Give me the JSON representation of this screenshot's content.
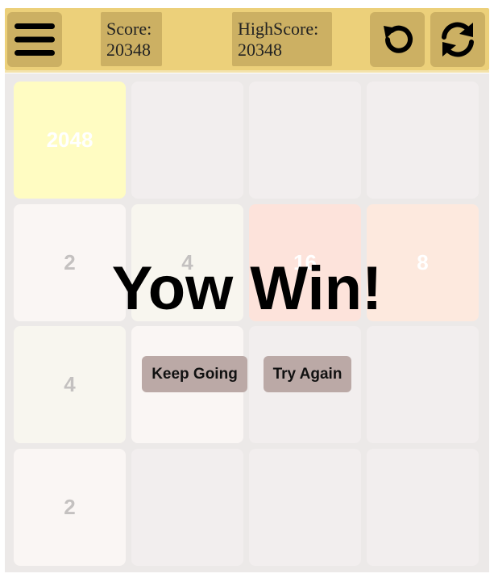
{
  "header": {
    "menu_icon": "hamburger-menu-icon",
    "score_label": "Score:",
    "score_value": "20348",
    "highscore_label": "HighScore:",
    "highscore_value": "20348",
    "undo_icon": "undo-icon",
    "restart_icon": "refresh-icon"
  },
  "board": {
    "rows": [
      [
        "2048",
        "",
        "",
        ""
      ],
      [
        "2",
        "4",
        "16",
        "8"
      ],
      [
        "4",
        "",
        "",
        ""
      ],
      [
        "2",
        "",
        "",
        ""
      ]
    ]
  },
  "overlay": {
    "title": "Yow Win!",
    "keep_going_label": "Keep Going",
    "try_again_label": "Try Again"
  },
  "colors": {
    "header_bg": "#ecd07a",
    "header_button_bg": "#ccb063",
    "board_bg": "#ece9e8",
    "empty_tile": "#f2eeee",
    "tile_2048": "#fffcc2",
    "tile_16": "#fde3db",
    "tile_8": "#fde9de",
    "overlay_button_bg": "#bba9a6"
  }
}
